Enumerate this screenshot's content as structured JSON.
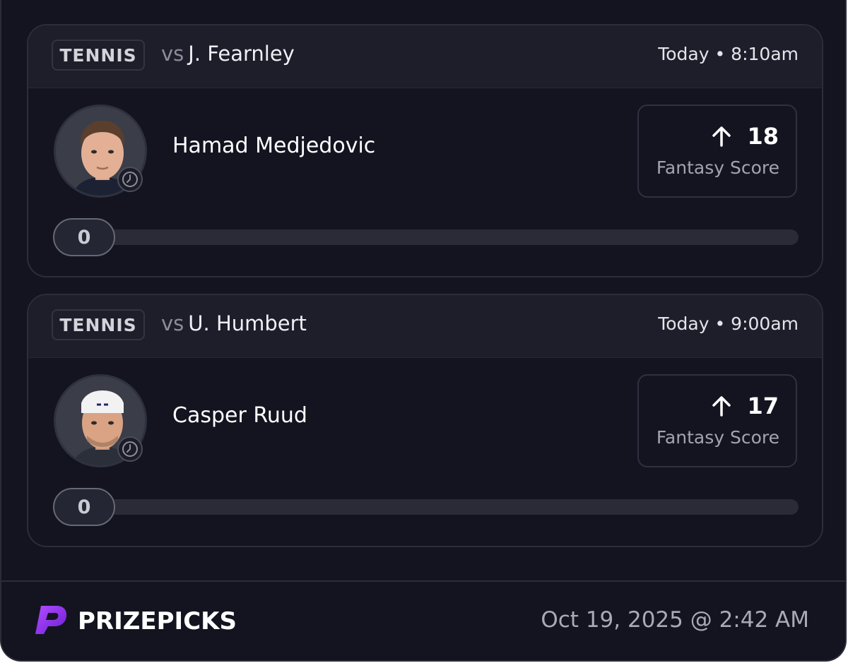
{
  "picks": [
    {
      "sport": "TENNIS",
      "vs_prefix": "vs",
      "opponent": "J. Fearnley",
      "time": "Today • 8:10am",
      "player": "Hamad Medjedovic",
      "score_value": "18",
      "score_direction": "arrow-up-icon",
      "score_label": "Fantasy Score",
      "progress": "0"
    },
    {
      "sport": "TENNIS",
      "vs_prefix": "vs",
      "opponent": "U. Humbert",
      "time": "Today • 9:00am",
      "player": "Casper Ruud",
      "score_value": "17",
      "score_direction": "arrow-up-icon",
      "score_label": "Fantasy Score",
      "progress": "0"
    }
  ],
  "footer": {
    "brand": "PRIZEPICKS",
    "timestamp": "Oct 19, 2025 @ 2:42 AM"
  },
  "colors": {
    "background": "#131420",
    "header": "#1d1e2a",
    "brand_purple": "#8a2be2"
  }
}
